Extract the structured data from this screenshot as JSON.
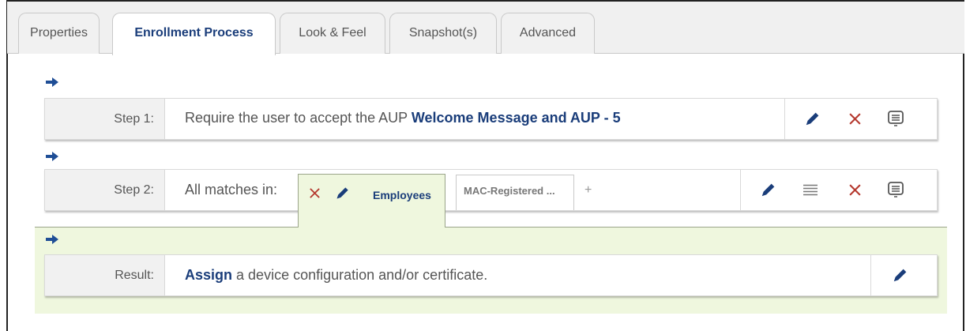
{
  "tabs": [
    {
      "label": "Properties",
      "active": false
    },
    {
      "label": "Enrollment Process",
      "active": true
    },
    {
      "label": "Look & Feel",
      "active": false
    },
    {
      "label": "Snapshot(s)",
      "active": false
    },
    {
      "label": "Advanced",
      "active": false
    }
  ],
  "step1": {
    "label": "Step 1:",
    "text": "Require the user to accept the AUP",
    "link": "Welcome Message and AUP - 5"
  },
  "step2": {
    "label": "Step 2:",
    "text": "All matches in:",
    "chips": [
      "Employees",
      "MAC-Registered ..."
    ],
    "add": "+"
  },
  "result": {
    "label": "Result:",
    "action": "Assign",
    "text": "a device configuration and/or certificate."
  },
  "colors": {
    "accent": "#1a3d7a",
    "arrow": "#1f4e96",
    "delete": "#b5392f",
    "result_bg": "#eff7de"
  },
  "icons": [
    "arrow-right-icon",
    "pencil-icon",
    "close-icon",
    "message-icon",
    "list-icon",
    "plus-icon"
  ]
}
